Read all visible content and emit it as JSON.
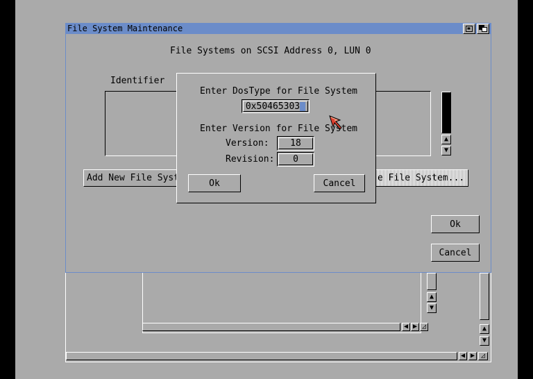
{
  "main_window": {
    "title": "File System Maintenance",
    "header": "File Systems on  SCSI  Address 0, LUN 0",
    "list_header": "Identifier",
    "add_button": "Add New File Syst",
    "edit_button": "e File System...",
    "ok_button": "Ok",
    "cancel_button": "Cancel"
  },
  "dialog": {
    "dostype_label": "Enter DosType for File System",
    "dostype_value": "0x50465303",
    "version_label": "Enter Version for File System",
    "version_field_label": "Version:",
    "version_value": "18",
    "revision_field_label": "Revision:",
    "revision_value": "0",
    "ok_button": "Ok",
    "cancel_button": "Cancel"
  },
  "icons": {
    "pointer": "mouse-pointer-icon",
    "depth": "depth-gadget-icon",
    "zoom": "zoom-gadget-icon",
    "scroll_up": "arrow-up-icon",
    "scroll_down": "arrow-down-icon",
    "scroll_left": "arrow-left-icon",
    "scroll_right": "arrow-right-icon",
    "resize": "resize-icon"
  },
  "colors": {
    "screen_bg": "#aaaaaa",
    "title_bar": "#6b8cc9",
    "pointer": "#e04030"
  }
}
